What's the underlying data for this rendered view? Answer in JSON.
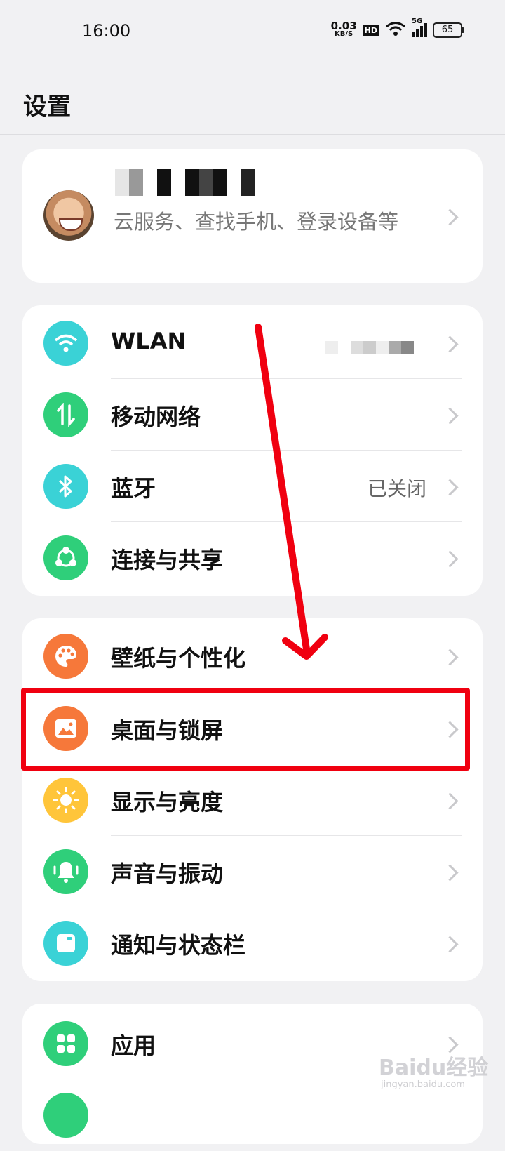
{
  "status": {
    "time": "16:00",
    "net_speed_value": "0.03",
    "net_speed_unit": "KB/S",
    "hd": "HD",
    "network": "5G",
    "battery": "65"
  },
  "header": {
    "title": "设置"
  },
  "profile": {
    "subtitle": "云服务、查找手机、登录设备等"
  },
  "group1": [
    {
      "label": "WLAN",
      "value": "",
      "icon": "wifi-icon",
      "color": "#3ad2d6"
    },
    {
      "label": "移动网络",
      "value": "",
      "icon": "mobile-data-icon",
      "color": "#2fcf7a"
    },
    {
      "label": "蓝牙",
      "value": "已关闭",
      "icon": "bluetooth-icon",
      "color": "#3ad2d6"
    },
    {
      "label": "连接与共享",
      "value": "",
      "icon": "share-icon",
      "color": "#2fcf7a"
    }
  ],
  "group2": [
    {
      "label": "壁纸与个性化",
      "icon": "palette-icon",
      "color": "#f6783a"
    },
    {
      "label": "桌面与锁屏",
      "icon": "wallpaper-icon",
      "color": "#f6783a"
    },
    {
      "label": "显示与亮度",
      "icon": "brightness-icon",
      "color": "#ffc53a"
    },
    {
      "label": "声音与振动",
      "icon": "bell-icon",
      "color": "#2fcf7a"
    },
    {
      "label": "通知与状态栏",
      "icon": "notification-icon",
      "color": "#3ad2d6"
    }
  ],
  "group3": [
    {
      "label": "应用",
      "icon": "apps-icon",
      "color": "#2fcf7a"
    }
  ],
  "annotation_color": "#f00010",
  "watermark": {
    "brand": "Baidu经验",
    "url": "jingyan.baidu.com"
  }
}
